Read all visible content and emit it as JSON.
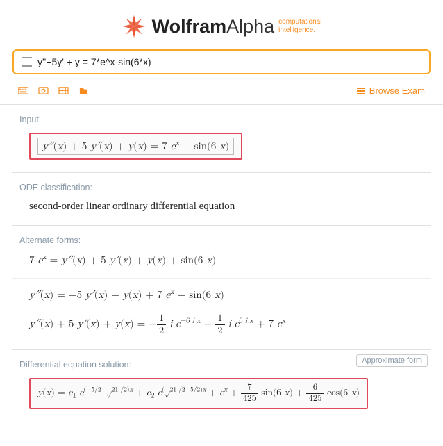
{
  "header": {
    "logo_bold": "Wolfram",
    "logo_light": "Alpha",
    "tagline1": "computational",
    "tagline2": "intelligence."
  },
  "search": {
    "value": "y''+5y' + y = 7*e^x-sin(6*x)"
  },
  "toolbar": {
    "browse_label": "Browse Exam"
  },
  "pods": {
    "input": {
      "title": "Input:",
      "math": "y″(x) + 5 y′(x) + y(x) = 7 e^x − sin(6 x)"
    },
    "classification": {
      "title": "ODE classification:",
      "text": "second-order linear ordinary differential equation"
    },
    "alternate": {
      "title": "Alternate forms:",
      "line1": "7 e^x = y″(x) + 5 y′(x) + y(x) + sin(6 x)",
      "line2": "y″(x) = −5 y′(x) − y(x) + 7 e^x − sin(6 x)",
      "line3_a": "y″(x) + 5 y′(x) + y(x) = −",
      "line3_b": " i e^{−6 i x} + ",
      "line3_c": " i e^{6 i x} + 7 e^x",
      "half_num": "1",
      "half_den": "2"
    },
    "solution": {
      "title": "Differential equation solution:",
      "approx_btn": "Approximate form",
      "lhs": "y(x) = c₁ e",
      "exp1": "(−5/2−√21 /2)x",
      "mid1": " + c₂ e",
      "exp2": "(√21 /2−5/2)x",
      "mid2": " + e^x + ",
      "f1_num": "7",
      "f1_den": "425",
      "tail1": " sin(6 x) + ",
      "f2_num": "6",
      "f2_den": "425",
      "tail2": " cos(6 x)"
    }
  }
}
